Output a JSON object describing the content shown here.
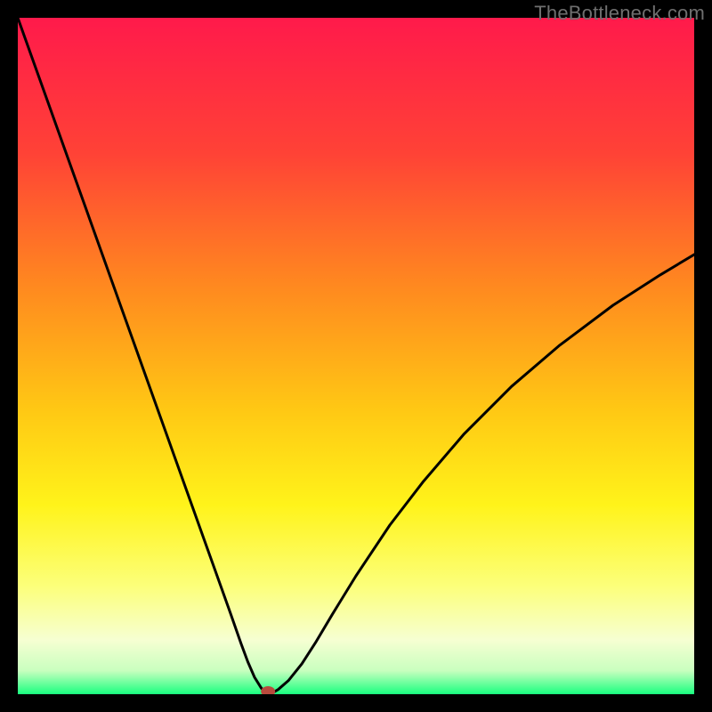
{
  "watermark": {
    "text": "TheBottleneck.com"
  },
  "chart_data": {
    "type": "line",
    "title": "",
    "xlabel": "",
    "ylabel": "",
    "xlim": [
      0,
      100
    ],
    "ylim": [
      0,
      100
    ],
    "grid": false,
    "legend": null,
    "background_gradient_stops": [
      {
        "offset": 0.0,
        "color": "#ff1a4b"
      },
      {
        "offset": 0.2,
        "color": "#ff4236"
      },
      {
        "offset": 0.4,
        "color": "#ff8a1f"
      },
      {
        "offset": 0.58,
        "color": "#ffc814"
      },
      {
        "offset": 0.72,
        "color": "#fff31a"
      },
      {
        "offset": 0.84,
        "color": "#fcff7a"
      },
      {
        "offset": 0.92,
        "color": "#f6ffd2"
      },
      {
        "offset": 0.965,
        "color": "#c9ffbf"
      },
      {
        "offset": 1.0,
        "color": "#19ff7f"
      }
    ],
    "series": [
      {
        "name": "bottleneck-curve",
        "color": "#000000",
        "x": [
          0.0,
          2.5,
          5.0,
          7.5,
          10.0,
          12.5,
          15.0,
          17.5,
          20.0,
          22.5,
          25.0,
          27.5,
          30.0,
          31.5,
          33.0,
          34.0,
          35.0,
          36.0,
          36.7,
          37.5,
          38.5,
          40.0,
          42.0,
          44.0,
          46.5,
          50.0,
          55.0,
          60.0,
          66.0,
          73.0,
          80.0,
          88.0,
          95.0,
          100.0
        ],
        "y": [
          100.0,
          93.0,
          86.0,
          79.0,
          72.0,
          65.0,
          58.0,
          51.0,
          44.0,
          37.0,
          30.0,
          23.0,
          16.0,
          11.8,
          7.5,
          4.8,
          2.5,
          0.9,
          0.1,
          0.1,
          0.7,
          2.0,
          4.5,
          7.6,
          11.8,
          17.5,
          25.0,
          31.5,
          38.5,
          45.5,
          51.5,
          57.5,
          62.0,
          65.0
        ]
      }
    ],
    "marker": {
      "name": "optimal-point",
      "x": 37.0,
      "y": 0.4,
      "color": "#b94a3d",
      "rx": 8,
      "ry": 6
    }
  }
}
